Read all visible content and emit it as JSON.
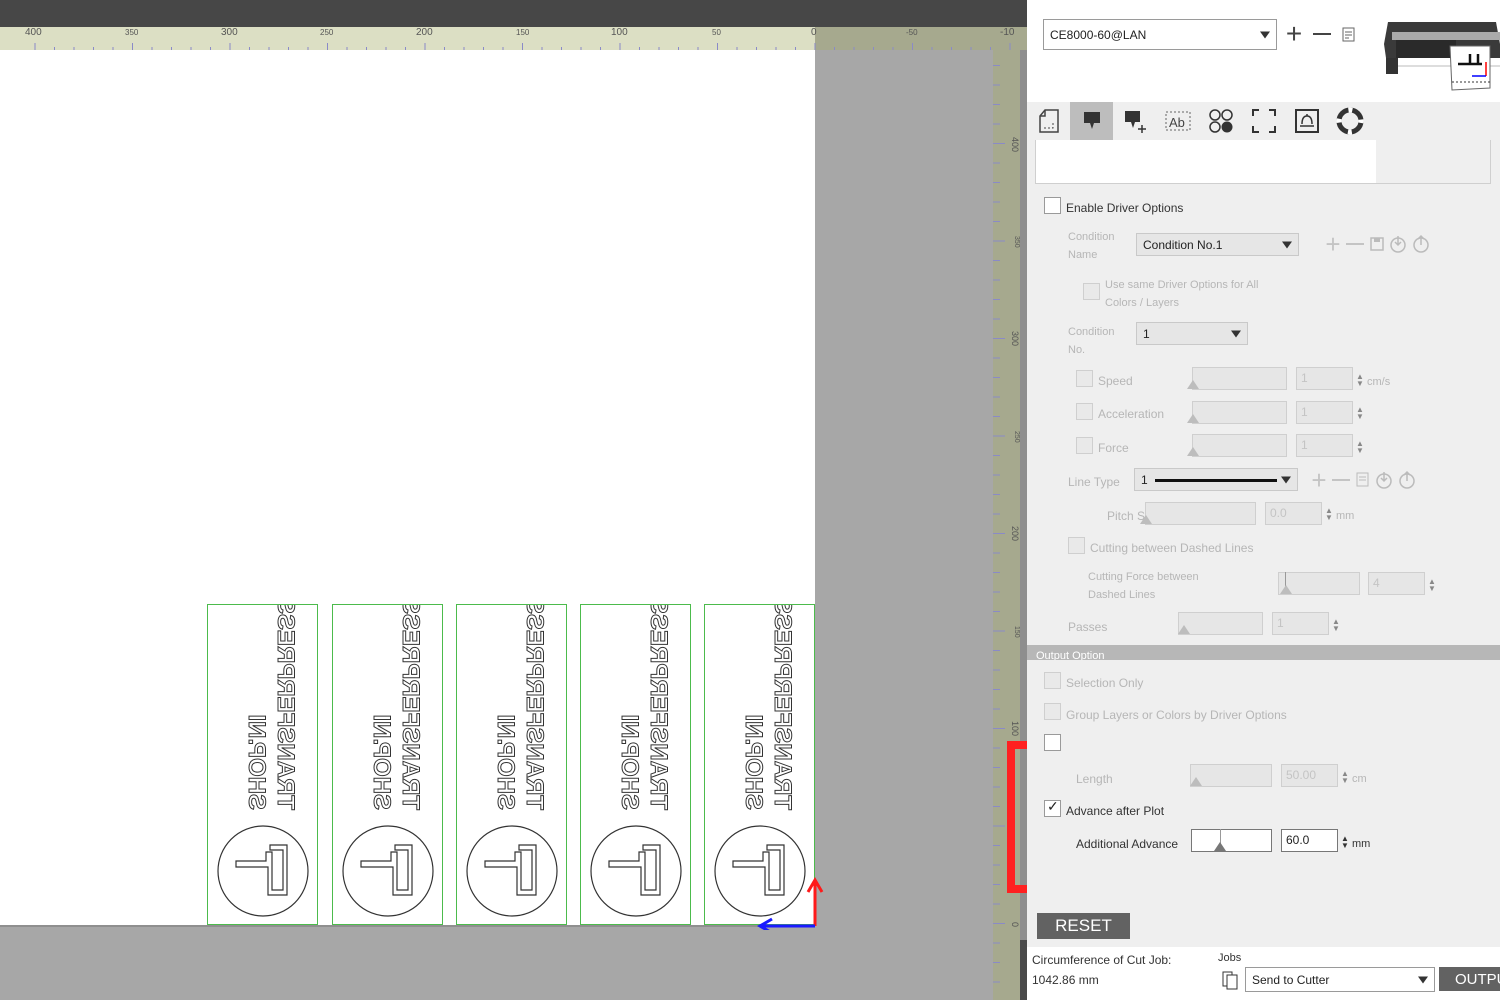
{
  "ruler_top": {
    "labels": [
      "400",
      "350",
      "300",
      "250",
      "200",
      "150",
      "100",
      "50",
      "0",
      "-50",
      "-10"
    ]
  },
  "ruler_side": {
    "labels": [
      "400",
      "350",
      "300",
      "250",
      "200",
      "150",
      "100",
      "0"
    ]
  },
  "canvas": {
    "label_text_line1": "TRANSFERPRESS",
    "label_text_line2": "SHOP.NI",
    "label_count": 5,
    "colors": {
      "strip_border": "#4cbb4c",
      "origin_x_axis": "#1a1aff",
      "origin_y_axis": "#ff1a1a"
    }
  },
  "panel": {
    "device_select": "CE8000-60@LAN",
    "device_buttons": [
      "plus-icon",
      "minus-icon",
      "edit-icon"
    ],
    "tabs": [
      {
        "icon": "page-setup-icon",
        "active": false
      },
      {
        "icon": "cutting-condition-icon",
        "active": true
      },
      {
        "icon": "add-condition-icon",
        "active": false
      },
      {
        "icon": "text-outline-icon",
        "active": false
      },
      {
        "icon": "layers-icon",
        "active": false
      },
      {
        "icon": "registration-marks-icon",
        "active": false
      },
      {
        "icon": "tile-icon",
        "active": false
      },
      {
        "icon": "help-icon",
        "active": false
      }
    ],
    "enable_driver_options": {
      "label": "Enable Driver Options",
      "checked": false
    },
    "condition_name": {
      "label_line1": "Condition",
      "label_line2": "Name",
      "value": "Condition No.1"
    },
    "use_same_driver_options": {
      "label_line1": "Use same Driver Options for All",
      "label_line2": "Colors / Layers",
      "checked": false
    },
    "condition_no": {
      "label_line1": "Condition",
      "label_line2": "No.",
      "value": "1"
    },
    "speed": {
      "label": "Speed",
      "value": "1",
      "unit": "cm/s",
      "checked": false
    },
    "acceleration": {
      "label": "Acceleration",
      "value": "1",
      "checked": false
    },
    "force": {
      "label": "Force",
      "value": "1",
      "checked": false
    },
    "line_type": {
      "label": "Line Type",
      "value": "1"
    },
    "pitch_size": {
      "label": "Pitch Size",
      "value": "0.0",
      "unit": "mm"
    },
    "cutting_between_dashed": {
      "label": "Cutting between Dashed Lines",
      "checked": false
    },
    "cutting_force_dashed": {
      "label_line1": "Cutting Force between",
      "label_line2": "Dashed Lines",
      "value": "4"
    },
    "passes": {
      "label": "Passes",
      "value": "1"
    },
    "output_section_title": "Output Option",
    "selection_only": {
      "label": "Selection Only",
      "checked": false
    },
    "group_layers": {
      "label": "Group Layers or Colors by Driver Options",
      "checked": false
    },
    "length": {
      "label": "Length",
      "value": "50.00",
      "unit": "cm"
    },
    "advance_after_plot": {
      "label": "Advance after Plot",
      "checked": true
    },
    "additional_advance": {
      "label": "Additional Advance",
      "value": "60.0",
      "unit": "mm",
      "slider_fraction": 0.35
    },
    "reset_label": "RESET",
    "circumference_label": "Circumference of Cut Job:",
    "circumference_value": "1042.86 mm",
    "jobs_label": "Jobs",
    "jobs_select": "Send to Cutter",
    "output_label": "OUTPUT"
  },
  "highlight_color": "#ff2020"
}
